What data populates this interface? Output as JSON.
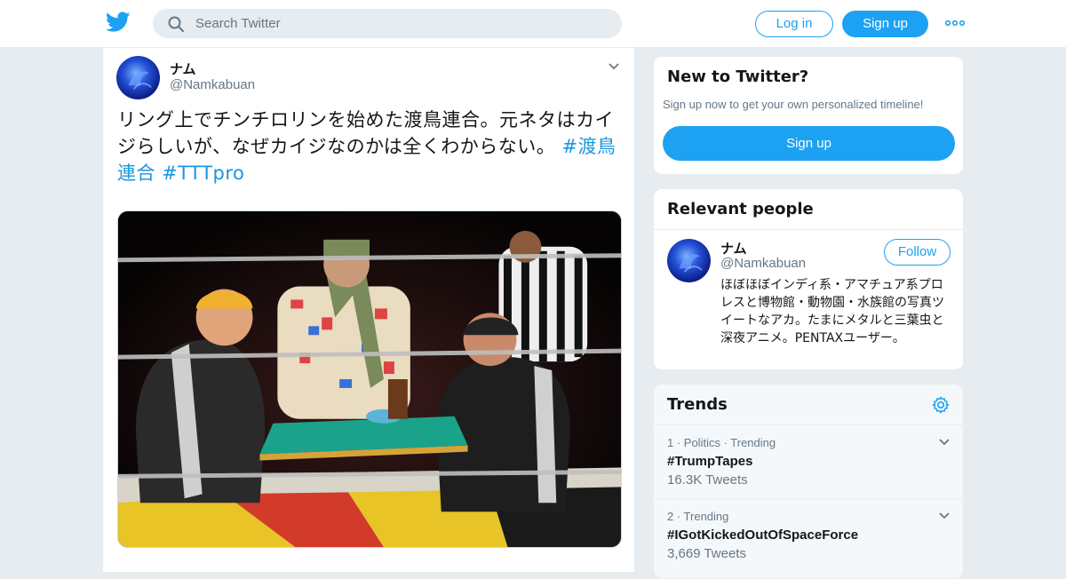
{
  "topbar": {
    "search_placeholder": "Search Twitter",
    "login_label": "Log in",
    "signup_label": "Sign up"
  },
  "tweet": {
    "author_name": "ナム",
    "author_handle": "@Namkabuan",
    "text": "リング上でチンチロリンを始めた渡鳥連合。元ネタはカイジらしいが、なぜカイジなのかは全くわからない。",
    "hashtags": [
      "#渡鳥連合",
      "#TTTpro"
    ]
  },
  "new_to_twitter": {
    "title": "New to Twitter?",
    "subtitle": "Sign up now to get your own personalized timeline!",
    "button_label": "Sign up"
  },
  "relevant_people": {
    "title": "Relevant people",
    "person": {
      "name": "ナム",
      "handle": "@Namkabuan",
      "follow_label": "Follow",
      "bio": "ほぼほぼインディ系・アマチュア系プロレスと博物館・動物園・水族館の写真ツイートなアカ。たまにメタルと三葉虫と深夜アニメ。PENTAXユーザー。"
    }
  },
  "trends": {
    "title": "Trends",
    "items": [
      {
        "meta": "1 · Politics · Trending",
        "name": "#TrumpTapes",
        "count": "16.3K Tweets"
      },
      {
        "meta": "2 · Trending",
        "name": "#IGotKickedOutOfSpaceForce",
        "count": "3,669 Tweets"
      }
    ]
  },
  "colors": {
    "brand": "#1da1f2",
    "hashtag": "#1b95e0",
    "muted": "#657786",
    "background": "#e6ecf0"
  },
  "icons": [
    "twitter-bird-icon",
    "search-icon",
    "more-dots-icon",
    "chevron-down-icon",
    "gear-icon"
  ]
}
